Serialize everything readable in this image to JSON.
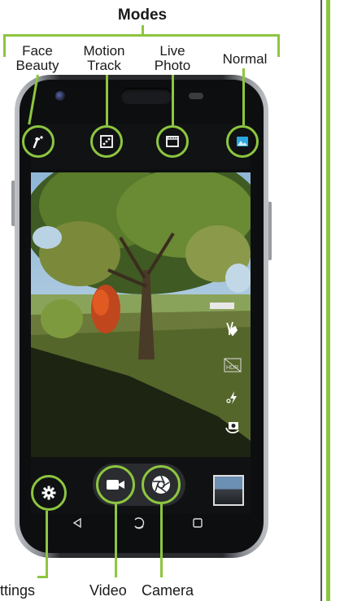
{
  "title": "Modes",
  "modes": {
    "face_beauty": {
      "line1": "Face",
      "line2": "Beauty"
    },
    "motion_track": {
      "line1": "Motion",
      "line2": "Track"
    },
    "live_photo": {
      "line1": "Live",
      "line2": "Photo"
    },
    "normal": "Normal"
  },
  "bottom_labels": {
    "settings": "ttings",
    "video": "Video",
    "camera": "Camera"
  },
  "side_icons": {
    "hdr_label": "HDR"
  },
  "colors": {
    "accent_green": "#8dc63f",
    "normal_mode_blue": "#2aa7e0"
  },
  "icons": [
    "face-beauty-icon",
    "motion-track-icon",
    "live-photo-icon",
    "normal-mode-icon",
    "gesture-icon",
    "hdr-icon",
    "flash-icon",
    "switch-camera-icon",
    "settings-gear-icon",
    "video-camera-icon",
    "shutter-aperture-icon",
    "back-nav-icon",
    "home-nav-icon",
    "recents-nav-icon"
  ]
}
